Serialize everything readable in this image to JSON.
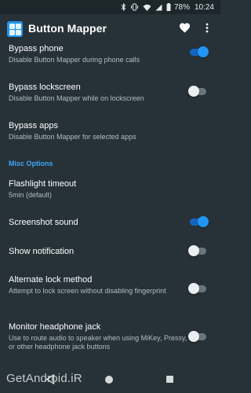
{
  "status_bar": {
    "battery_percent": "78%",
    "time": "10:24"
  },
  "app_bar": {
    "title": "Button Mapper"
  },
  "settings_top": [
    {
      "title": "Bypass phone",
      "summary": "Disable Button Mapper during phone calls",
      "switch_on": true
    },
    {
      "title": "Bypass lockscreen",
      "summary": "Disable Button Mapper while on lockscreen",
      "switch_on": false
    },
    {
      "title": "Bypass apps",
      "summary": "Disable Button Mapper for selected apps"
    }
  ],
  "misc_section": {
    "header": "Misc Options",
    "items": [
      {
        "title": "Flashlight timeout",
        "summary": "5min (default)"
      },
      {
        "title": "Screenshot sound",
        "switch_on": true
      },
      {
        "title": "Show notification",
        "switch_on": false
      },
      {
        "title": "Alternate lock method",
        "summary": "Attempt to lock screen without disabling fingerprint",
        "switch_on": false
      },
      {
        "title": "Monitor headphone jack",
        "summary": "Use to route audio to speaker when using MiKey, Pressy, or other headphone jack buttons",
        "switch_on": false
      }
    ]
  },
  "watermark": "GetAndroid.iR",
  "colors": {
    "background": "#263238",
    "accent": "#2196f3",
    "section_header": "#42a5f5"
  }
}
